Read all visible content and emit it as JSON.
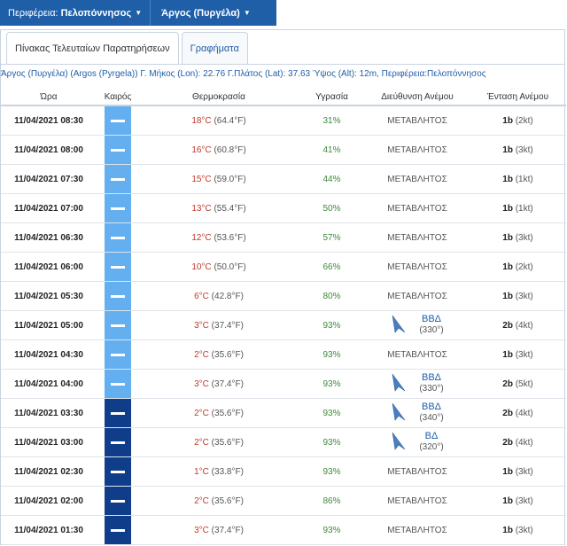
{
  "topbar": {
    "region_label": "Περιφέρεια:",
    "region_value": "Πελοπόννησος",
    "station_value": "Άργος (Πυργέλα)"
  },
  "tabs": [
    {
      "label": "Πίνακας Τελευταίων Παρατηρήσεων"
    },
    {
      "label": "Γραφήματα"
    }
  ],
  "station_info": "Άργος (Πυργέλα) (Argos (Pyrgela)) Γ. Μήκος (Lon): 22.76 Γ.Πλάτος (Lat): 37.63 Ύψος (Alt): 12m, Περιφέρεια:Πελοπόννησος",
  "headers": {
    "time": "Ώρα",
    "weather": "Καιρός",
    "temperature": "Θερμοκρασία",
    "humidity": "Υγρασία",
    "wind_dir": "Διεύθυνση Ανέμου",
    "wind_speed": "Ένταση Ανέμου"
  },
  "colors": {
    "accent": "#1f5fa8",
    "light_sky": "#63aff0",
    "dark_sky": "#0f3d8a"
  },
  "rows": [
    {
      "time": "11/04/2021 08:30",
      "sky": "light",
      "temp_c": "18°C",
      "temp_f": "(64.4°F)",
      "humidity": "31%",
      "dir_text": "ΜΕΤΑΒΛΗΤΟΣ",
      "dir_abbr": "",
      "dir_deg": "",
      "beaufort": "1b",
      "knots": "(2kt)"
    },
    {
      "time": "11/04/2021 08:00",
      "sky": "light",
      "temp_c": "16°C",
      "temp_f": "(60.8°F)",
      "humidity": "41%",
      "dir_text": "ΜΕΤΑΒΛΗΤΟΣ",
      "dir_abbr": "",
      "dir_deg": "",
      "beaufort": "1b",
      "knots": "(3kt)"
    },
    {
      "time": "11/04/2021 07:30",
      "sky": "light",
      "temp_c": "15°C",
      "temp_f": "(59.0°F)",
      "humidity": "44%",
      "dir_text": "ΜΕΤΑΒΛΗΤΟΣ",
      "dir_abbr": "",
      "dir_deg": "",
      "beaufort": "1b",
      "knots": "(1kt)"
    },
    {
      "time": "11/04/2021 07:00",
      "sky": "light",
      "temp_c": "13°C",
      "temp_f": "(55.4°F)",
      "humidity": "50%",
      "dir_text": "ΜΕΤΑΒΛΗΤΟΣ",
      "dir_abbr": "",
      "dir_deg": "",
      "beaufort": "1b",
      "knots": "(1kt)"
    },
    {
      "time": "11/04/2021 06:30",
      "sky": "light",
      "temp_c": "12°C",
      "temp_f": "(53.6°F)",
      "humidity": "57%",
      "dir_text": "ΜΕΤΑΒΛΗΤΟΣ",
      "dir_abbr": "",
      "dir_deg": "",
      "beaufort": "1b",
      "knots": "(3kt)"
    },
    {
      "time": "11/04/2021 06:00",
      "sky": "light",
      "temp_c": "10°C",
      "temp_f": "(50.0°F)",
      "humidity": "66%",
      "dir_text": "ΜΕΤΑΒΛΗΤΟΣ",
      "dir_abbr": "",
      "dir_deg": "",
      "beaufort": "1b",
      "knots": "(2kt)"
    },
    {
      "time": "11/04/2021 05:30",
      "sky": "light",
      "temp_c": "6°C",
      "temp_f": "(42.8°F)",
      "humidity": "80%",
      "dir_text": "ΜΕΤΑΒΛΗΤΟΣ",
      "dir_abbr": "",
      "dir_deg": "",
      "beaufort": "1b",
      "knots": "(3kt)"
    },
    {
      "time": "11/04/2021 05:00",
      "sky": "light",
      "temp_c": "3°C",
      "temp_f": "(37.4°F)",
      "humidity": "93%",
      "dir_text": "",
      "dir_abbr": "ΒΒΔ",
      "dir_deg": "(330°)",
      "beaufort": "2b",
      "knots": "(4kt)"
    },
    {
      "time": "11/04/2021 04:30",
      "sky": "light",
      "temp_c": "2°C",
      "temp_f": "(35.6°F)",
      "humidity": "93%",
      "dir_text": "ΜΕΤΑΒΛΗΤΟΣ",
      "dir_abbr": "",
      "dir_deg": "",
      "beaufort": "1b",
      "knots": "(3kt)"
    },
    {
      "time": "11/04/2021 04:00",
      "sky": "light",
      "temp_c": "3°C",
      "temp_f": "(37.4°F)",
      "humidity": "93%",
      "dir_text": "",
      "dir_abbr": "ΒΒΔ",
      "dir_deg": "(330°)",
      "beaufort": "2b",
      "knots": "(5kt)"
    },
    {
      "time": "11/04/2021 03:30",
      "sky": "dark",
      "temp_c": "2°C",
      "temp_f": "(35.6°F)",
      "humidity": "93%",
      "dir_text": "",
      "dir_abbr": "ΒΒΔ",
      "dir_deg": "(340°)",
      "beaufort": "2b",
      "knots": "(4kt)"
    },
    {
      "time": "11/04/2021 03:00",
      "sky": "dark",
      "temp_c": "2°C",
      "temp_f": "(35.6°F)",
      "humidity": "93%",
      "dir_text": "",
      "dir_abbr": "ΒΔ",
      "dir_deg": "(320°)",
      "beaufort": "2b",
      "knots": "(4kt)"
    },
    {
      "time": "11/04/2021 02:30",
      "sky": "dark",
      "temp_c": "1°C",
      "temp_f": "(33.8°F)",
      "humidity": "93%",
      "dir_text": "ΜΕΤΑΒΛΗΤΟΣ",
      "dir_abbr": "",
      "dir_deg": "",
      "beaufort": "1b",
      "knots": "(3kt)"
    },
    {
      "time": "11/04/2021 02:00",
      "sky": "dark",
      "temp_c": "2°C",
      "temp_f": "(35.6°F)",
      "humidity": "86%",
      "dir_text": "ΜΕΤΑΒΛΗΤΟΣ",
      "dir_abbr": "",
      "dir_deg": "",
      "beaufort": "1b",
      "knots": "(3kt)"
    },
    {
      "time": "11/04/2021 01:30",
      "sky": "dark",
      "temp_c": "3°C",
      "temp_f": "(37.4°F)",
      "humidity": "93%",
      "dir_text": "ΜΕΤΑΒΛΗΤΟΣ",
      "dir_abbr": "",
      "dir_deg": "",
      "beaufort": "1b",
      "knots": "(3kt)"
    }
  ]
}
